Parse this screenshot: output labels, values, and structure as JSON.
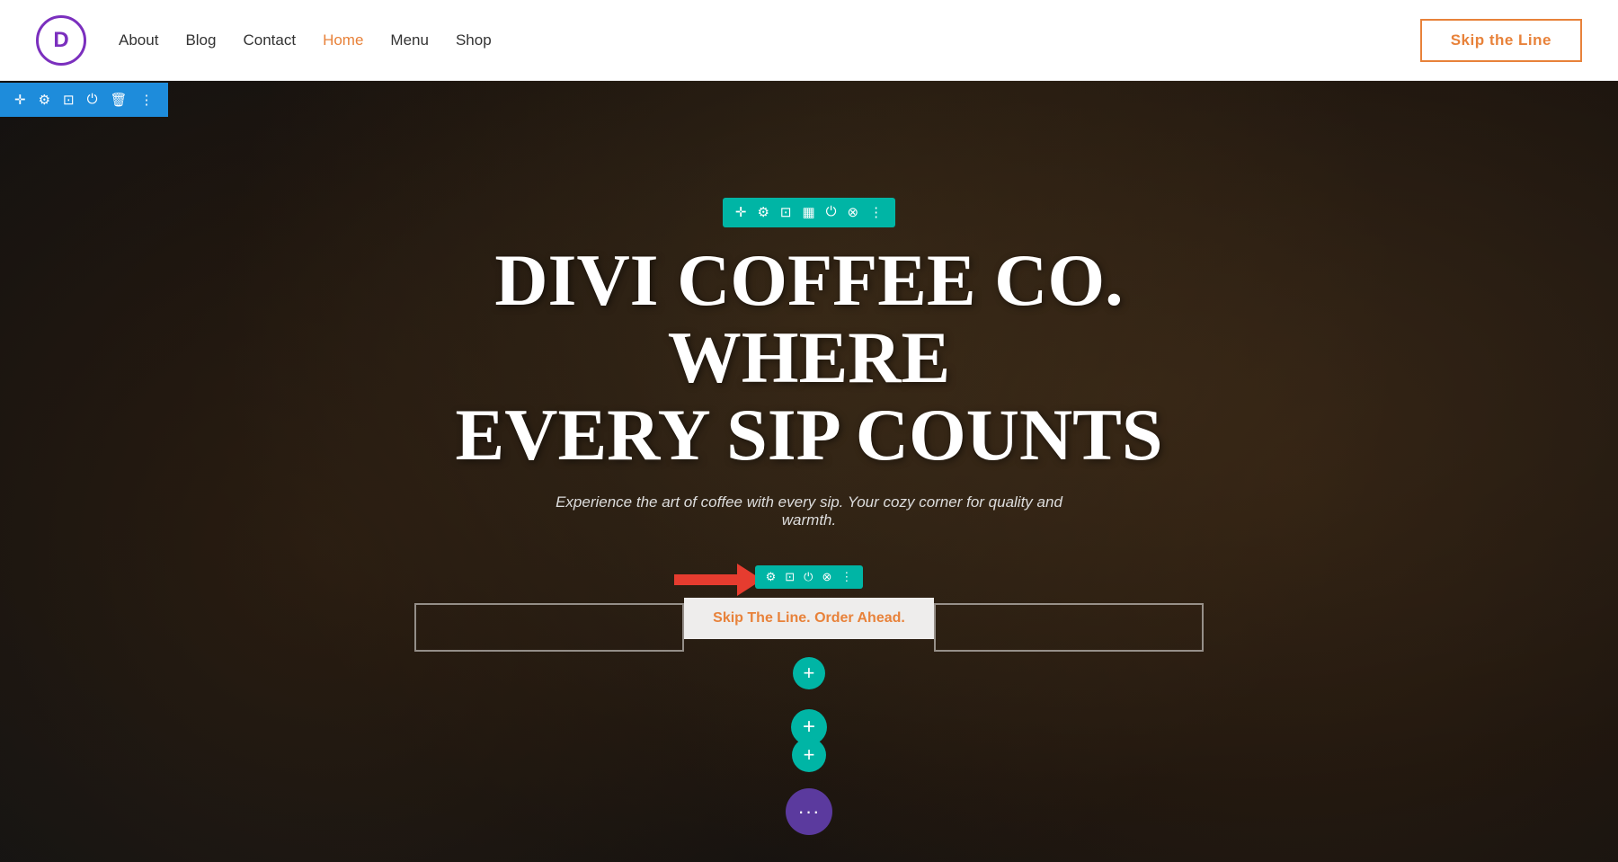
{
  "header": {
    "logo_letter": "D",
    "nav_items": [
      {
        "label": "About",
        "active": false
      },
      {
        "label": "Blog",
        "active": false
      },
      {
        "label": "Contact",
        "active": false
      },
      {
        "label": "Home",
        "active": true
      },
      {
        "label": "Menu",
        "active": false
      },
      {
        "label": "Shop",
        "active": false
      }
    ],
    "cta_label": "Skip the Line"
  },
  "hero": {
    "title_line1": "DIVI COFFEE CO. WHERE",
    "title_line2": "EVERY SIP COUNTS",
    "subtitle": "Experience the art of coffee with every sip. Your cozy corner for quality and warmth.",
    "button_label": "Skip The Line. Order Ahead.",
    "plus_icon": "+",
    "dots_icon": "···"
  },
  "toolbar": {
    "icons": [
      "✛",
      "⚙",
      "⊡",
      "⋮"
    ]
  },
  "module_toolbar": {
    "icons": [
      "✛",
      "⚙",
      "⊡",
      "▦",
      "⏻",
      "⊗",
      "⋮"
    ]
  },
  "button_toolbar": {
    "icons": [
      "⚙",
      "⊡",
      "⏻",
      "⊗",
      "⋮"
    ]
  },
  "colors": {
    "accent_orange": "#e8823a",
    "accent_teal": "#00b5a5",
    "accent_purple": "#5b3a9e",
    "logo_purple": "#7b2fbe",
    "nav_blue": "#1e8cdb",
    "arrow_red": "#e63c2f"
  }
}
